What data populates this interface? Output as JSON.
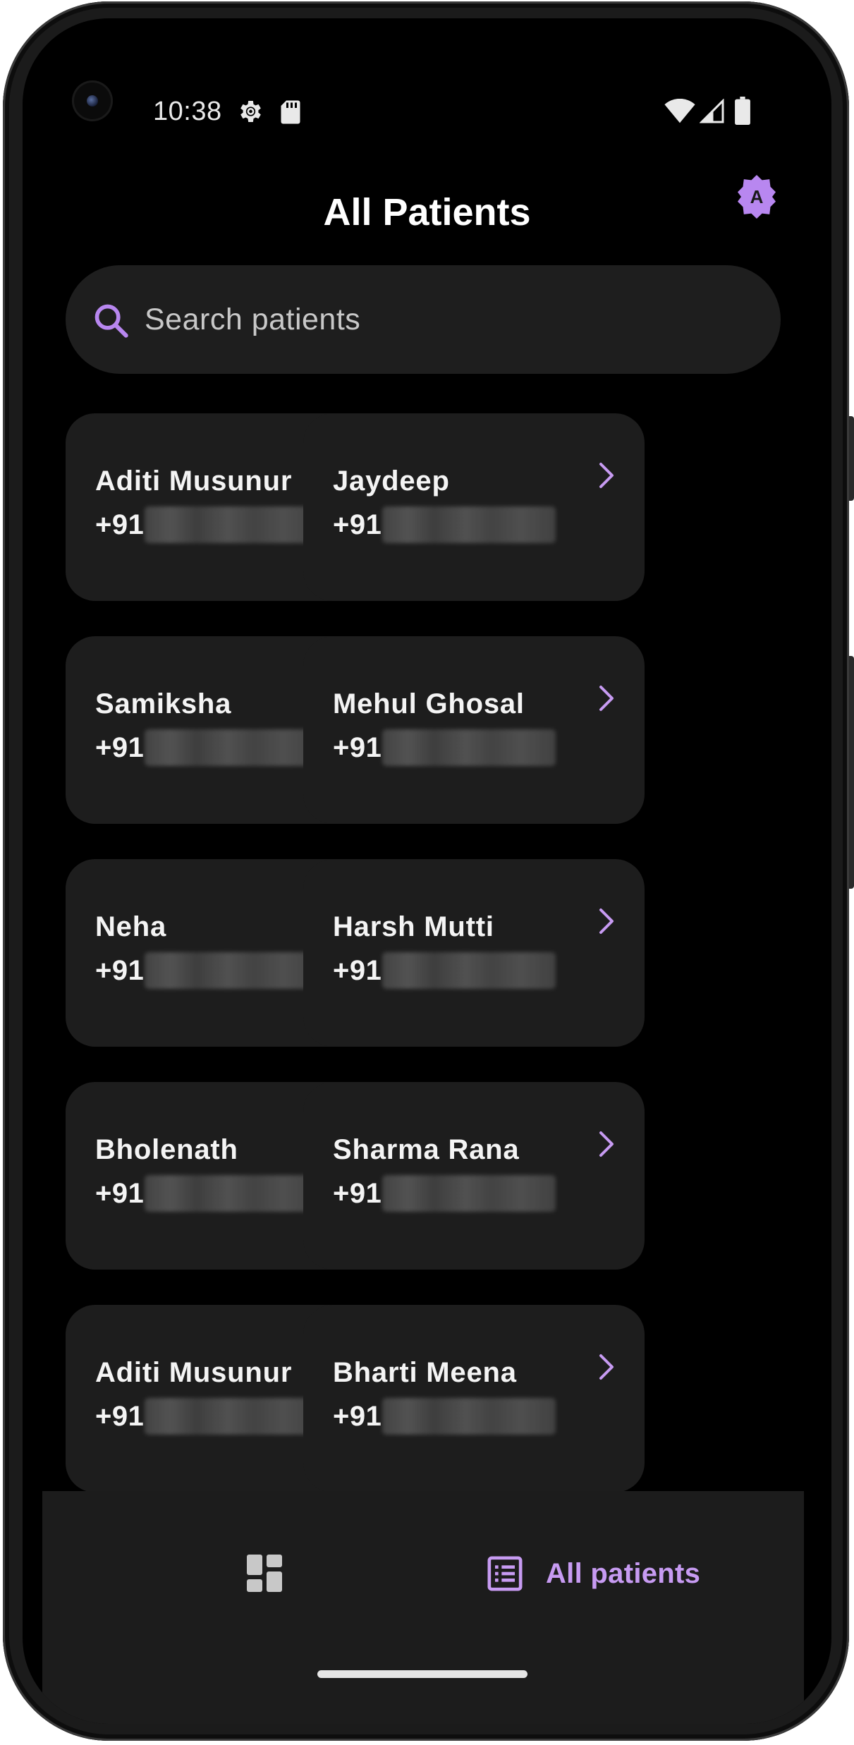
{
  "status_bar": {
    "time": "10:38",
    "icons": [
      "settings-gear-icon",
      "sd-card-icon",
      "wifi-icon",
      "cell-signal-icon",
      "battery-icon"
    ]
  },
  "header": {
    "title": "All Patients",
    "badge_letter": "A"
  },
  "search": {
    "placeholder": "Search patients",
    "value": ""
  },
  "patients": [
    {
      "name": "Aditi Musunur",
      "phone_prefix": "+91"
    },
    {
      "name": "Jaydeep",
      "phone_prefix": "+91"
    },
    {
      "name": "Samiksha",
      "phone_prefix": "+91"
    },
    {
      "name": "Mehul Ghosal",
      "phone_prefix": "+91"
    },
    {
      "name": "Neha",
      "phone_prefix": "+91"
    },
    {
      "name": "Harsh Mutti",
      "phone_prefix": "+91"
    },
    {
      "name": "Bholenath",
      "phone_prefix": "+91"
    },
    {
      "name": "Sharma Rana",
      "phone_prefix": "+91"
    },
    {
      "name": "Aditi Musunur",
      "phone_prefix": "+91"
    },
    {
      "name": "Bharti Meena",
      "phone_prefix": "+91"
    }
  ],
  "bottom_nav": {
    "dashboard_icon": "dashboard-icon",
    "all_patients_label": "All patients"
  },
  "colors": {
    "accent": "#c79bf2",
    "background": "#000000",
    "card": "#1d1d1d",
    "search_bar": "#1e1e1e",
    "nav_bar": "#1c1c1c"
  }
}
